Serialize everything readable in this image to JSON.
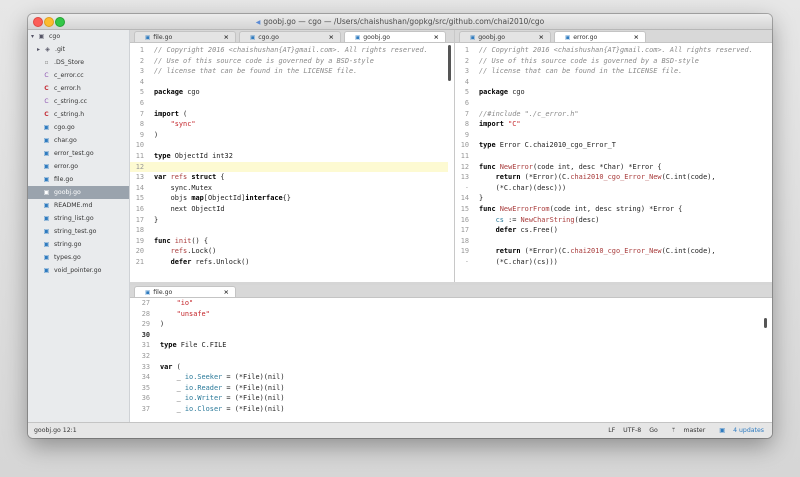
{
  "window": {
    "title": "goobj.go — cgo — /Users/chaishushan/gopkg/src/github.com/chai2010/cgo"
  },
  "sidebar": {
    "root": "cgo",
    "items": [
      {
        "name": ".git",
        "icon": "git-folder-icon",
        "kind": "folder"
      },
      {
        "name": ".DS_Store",
        "icon": "file-icon",
        "kind": "doc"
      },
      {
        "name": "c_error.cc",
        "icon": "cpp-file-icon",
        "kind": "cc"
      },
      {
        "name": "c_error.h",
        "icon": "c-file-icon",
        "kind": "c"
      },
      {
        "name": "c_string.cc",
        "icon": "cpp-file-icon",
        "kind": "cc"
      },
      {
        "name": "c_string.h",
        "icon": "c-file-icon",
        "kind": "c"
      },
      {
        "name": "cgo.go",
        "icon": "go-file-icon",
        "kind": "go"
      },
      {
        "name": "char.go",
        "icon": "go-file-icon",
        "kind": "go"
      },
      {
        "name": "error_test.go",
        "icon": "go-file-icon",
        "kind": "go"
      },
      {
        "name": "error.go",
        "icon": "go-file-icon",
        "kind": "go"
      },
      {
        "name": "file.go",
        "icon": "go-file-icon",
        "kind": "go"
      },
      {
        "name": "goobj.go",
        "icon": "go-file-icon",
        "kind": "go",
        "selected": true
      },
      {
        "name": "README.md",
        "icon": "markdown-file-icon",
        "kind": "go"
      },
      {
        "name": "string_list.go",
        "icon": "go-file-icon",
        "kind": "go"
      },
      {
        "name": "string_test.go",
        "icon": "go-file-icon",
        "kind": "go"
      },
      {
        "name": "string.go",
        "icon": "go-file-icon",
        "kind": "go"
      },
      {
        "name": "types.go",
        "icon": "go-file-icon",
        "kind": "go"
      },
      {
        "name": "void_pointer.go",
        "icon": "go-file-icon",
        "kind": "go"
      }
    ]
  },
  "tabs_left": [
    {
      "label": "file.go",
      "active": false
    },
    {
      "label": "cgo.go",
      "active": false
    },
    {
      "label": "goobj.go",
      "active": true
    }
  ],
  "tabs_right": [
    {
      "label": "goobj.go",
      "active": false
    },
    {
      "label": "error.go",
      "active": true
    }
  ],
  "tabs_bottom": [
    {
      "label": "file.go",
      "active": true
    }
  ],
  "editor_left": {
    "lines": [
      {
        "n": "1",
        "t": [
          [
            "cm",
            "// Copyright 2016 <chaishushan{AT}gmail.com>. All rights reserved."
          ]
        ]
      },
      {
        "n": "2",
        "t": [
          [
            "cm",
            "// Use of this source code is governed by a BSD-style"
          ]
        ]
      },
      {
        "n": "3",
        "t": [
          [
            "cm",
            "// license that can be found in the LICENSE file."
          ]
        ]
      },
      {
        "n": "4",
        "t": []
      },
      {
        "n": "5",
        "t": [
          [
            "kw",
            "package"
          ],
          [
            "plain",
            " cgo"
          ]
        ]
      },
      {
        "n": "6",
        "t": []
      },
      {
        "n": "7",
        "t": [
          [
            "kw",
            "import"
          ],
          [
            "plain",
            " ("
          ]
        ]
      },
      {
        "n": "8",
        "t": [
          [
            "plain",
            "    "
          ],
          [
            "st",
            "\"sync\""
          ]
        ]
      },
      {
        "n": "9",
        "t": [
          [
            "plain",
            ")"
          ]
        ]
      },
      {
        "n": "10",
        "t": []
      },
      {
        "n": "11",
        "t": [
          [
            "kw",
            "type"
          ],
          [
            "plain",
            " ObjectId int32"
          ]
        ]
      },
      {
        "n": "12",
        "t": [],
        "hl": true
      },
      {
        "n": "13",
        "t": [
          [
            "kw",
            "var"
          ],
          [
            "plain",
            " "
          ],
          [
            "fn",
            "refs"
          ],
          [
            "plain",
            " "
          ],
          [
            "kw",
            "struct"
          ],
          [
            "plain",
            " {"
          ]
        ]
      },
      {
        "n": "14",
        "t": [
          [
            "plain",
            "    sync.Mutex"
          ]
        ]
      },
      {
        "n": "15",
        "t": [
          [
            "plain",
            "    objs "
          ],
          [
            "kw",
            "map"
          ],
          [
            "plain",
            "[ObjectId]"
          ],
          [
            "kw",
            "interface"
          ],
          [
            "plain",
            "{}"
          ]
        ]
      },
      {
        "n": "16",
        "t": [
          [
            "plain",
            "    next ObjectId"
          ]
        ]
      },
      {
        "n": "17",
        "t": [
          [
            "plain",
            "}"
          ]
        ]
      },
      {
        "n": "18",
        "t": []
      },
      {
        "n": "19",
        "t": [
          [
            "kw",
            "func"
          ],
          [
            "plain",
            " "
          ],
          [
            "fn",
            "init"
          ],
          [
            "plain",
            "() {"
          ]
        ]
      },
      {
        "n": "20",
        "t": [
          [
            "plain",
            "    "
          ],
          [
            "fn",
            "refs"
          ],
          [
            "plain",
            ".Lock()"
          ]
        ]
      },
      {
        "n": "21",
        "t": [
          [
            "plain",
            "    "
          ],
          [
            "kw",
            "defer"
          ],
          [
            "plain",
            " refs.Unlock()"
          ]
        ]
      }
    ]
  },
  "editor_right": {
    "lines": [
      {
        "n": "1",
        "t": [
          [
            "cm",
            "// Copyright 2016 <chaishushan{AT}gmail.com>. All rights reserved."
          ]
        ]
      },
      {
        "n": "2",
        "t": [
          [
            "cm",
            "// Use of this source code is governed by a BSD-style"
          ]
        ]
      },
      {
        "n": "3",
        "t": [
          [
            "cm",
            "// license that can be found in the LICENSE file."
          ]
        ]
      },
      {
        "n": "4",
        "t": []
      },
      {
        "n": "5",
        "t": [
          [
            "kw",
            "package"
          ],
          [
            "plain",
            " cgo"
          ]
        ]
      },
      {
        "n": "6",
        "t": []
      },
      {
        "n": "7",
        "t": [
          [
            "cm",
            "//#include \"./c_error.h\""
          ]
        ]
      },
      {
        "n": "8",
        "t": [
          [
            "kw",
            "import"
          ],
          [
            "plain",
            " "
          ],
          [
            "st",
            "\"C\""
          ]
        ]
      },
      {
        "n": "9",
        "t": []
      },
      {
        "n": "10",
        "t": [
          [
            "kw",
            "type"
          ],
          [
            "plain",
            " Error C.chai2010_cgo_Error_T"
          ]
        ]
      },
      {
        "n": "11",
        "t": []
      },
      {
        "n": "12",
        "t": [
          [
            "kw",
            "func"
          ],
          [
            "plain",
            " "
          ],
          [
            "fn",
            "NewError"
          ],
          [
            "plain",
            "(code int, desc *Char) *Error {"
          ]
        ]
      },
      {
        "n": "13",
        "t": [
          [
            "plain",
            "    "
          ],
          [
            "kw",
            "return"
          ],
          [
            "plain",
            " (*Error)(C."
          ],
          [
            "fn",
            "chai2010_cgo_Error_New"
          ],
          [
            "plain",
            "(C.int(code),"
          ]
        ]
      },
      {
        "n": "·",
        "t": [
          [
            "plain",
            "    (*C.char)(desc)))"
          ]
        ]
      },
      {
        "n": "14",
        "t": [
          [
            "plain",
            "}"
          ]
        ]
      },
      {
        "n": "15",
        "t": [
          [
            "kw",
            "func"
          ],
          [
            "plain",
            " "
          ],
          [
            "fn",
            "NewErrorFrom"
          ],
          [
            "plain",
            "(code int, desc string) *Error {"
          ]
        ]
      },
      {
        "n": "16",
        "t": [
          [
            "plain",
            "    "
          ],
          [
            "pk",
            "cs"
          ],
          [
            "plain",
            " := "
          ],
          [
            "fn",
            "NewCharString"
          ],
          [
            "plain",
            "(desc)"
          ]
        ]
      },
      {
        "n": "17",
        "t": [
          [
            "plain",
            "    "
          ],
          [
            "kw",
            "defer"
          ],
          [
            "plain",
            " cs.Free()"
          ]
        ]
      },
      {
        "n": "18",
        "t": []
      },
      {
        "n": "19",
        "t": [
          [
            "plain",
            "    "
          ],
          [
            "kw",
            "return"
          ],
          [
            "plain",
            " (*Error)(C."
          ],
          [
            "fn",
            "chai2010_cgo_Error_New"
          ],
          [
            "plain",
            "(C.int(code),"
          ]
        ]
      },
      {
        "n": "·",
        "t": [
          [
            "plain",
            "    (*C.char)(cs)))"
          ]
        ]
      }
    ]
  },
  "editor_bottom": {
    "lines": [
      {
        "n": "27",
        "t": [
          [
            "plain",
            "    "
          ],
          [
            "st",
            "\"io\""
          ]
        ]
      },
      {
        "n": "28",
        "t": [
          [
            "plain",
            "    "
          ],
          [
            "st",
            "\"unsafe\""
          ]
        ]
      },
      {
        "n": "29",
        "t": [
          [
            "plain",
            ")"
          ]
        ]
      },
      {
        "n": "30",
        "t": [],
        "bold": true
      },
      {
        "n": "31",
        "t": [
          [
            "kw",
            "type"
          ],
          [
            "plain",
            " File C.FILE"
          ]
        ]
      },
      {
        "n": "32",
        "t": []
      },
      {
        "n": "33",
        "t": [
          [
            "kw",
            "var"
          ],
          [
            "plain",
            " ("
          ]
        ]
      },
      {
        "n": "34",
        "t": [
          [
            "plain",
            "    _ "
          ],
          [
            "pk",
            "io.Seeker"
          ],
          [
            "plain",
            " = (*File)(nil)"
          ]
        ]
      },
      {
        "n": "35",
        "t": [
          [
            "plain",
            "    _ "
          ],
          [
            "pk",
            "io.Reader"
          ],
          [
            "plain",
            " = (*File)(nil)"
          ]
        ]
      },
      {
        "n": "36",
        "t": [
          [
            "plain",
            "    _ "
          ],
          [
            "pk",
            "io.Writer"
          ],
          [
            "plain",
            " = (*File)(nil)"
          ]
        ]
      },
      {
        "n": "37",
        "t": [
          [
            "plain",
            "    _ "
          ],
          [
            "pk",
            "io.Closer"
          ],
          [
            "plain",
            " = (*File)(nil)"
          ]
        ]
      }
    ]
  },
  "status": {
    "position": "goobj.go  12:1",
    "line_ending": "LF",
    "encoding": "UTF-8",
    "grammar": "Go",
    "branch_icon": "git-branch-icon",
    "branch": "master",
    "updates_icon": "package-icon",
    "updates": "4 updates"
  }
}
